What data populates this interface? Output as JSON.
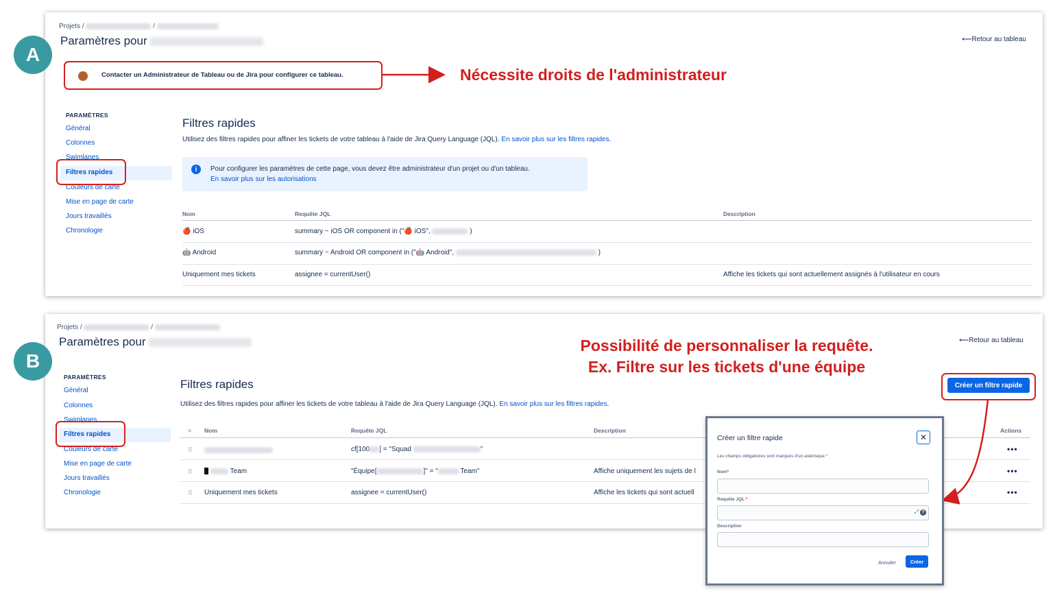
{
  "badges": {
    "a": "A",
    "b": "B"
  },
  "panel_a": {
    "breadcrumb": {
      "root": "Projets",
      "sep": "/"
    },
    "title_prefix": "Paramètres pour",
    "back_link": "Retour au tableau",
    "warning": "Contacter un Administrateur de Tableau ou de Jira pour configurer ce tableau.",
    "nav": {
      "heading": "PARAMÈTRES",
      "items": [
        "Général",
        "Colonnes",
        "Swimlanes",
        "Filtres rapides",
        "Couleurs de carte",
        "Mise en page de carte",
        "Jours travaillés",
        "Chronologie"
      ]
    },
    "section_title": "Filtres rapides",
    "section_desc": "Utilisez des filtres rapides pour affiner les tickets de votre tableau à l'aide de Jira Query Language (JQL).",
    "section_link": "En savoir plus sur les filtres rapides.",
    "info": {
      "text": "Pour configurer les paramètres de cette page, vous devez être administrateur d'un projet ou d'un tableau.",
      "link": "En savoir plus sur les autorisations"
    },
    "table": {
      "headers": [
        "Nom",
        "Requête JQL",
        "Description"
      ],
      "rows": [
        {
          "name": "🍎 iOS",
          "query": "summary ~ iOS OR component in (\"🍎 iOS\",",
          "query_end": ")",
          "description": ""
        },
        {
          "name": "🤖 Android",
          "query": "summary ~ Android OR component in (\"🤖 Android\",",
          "query_end": ")",
          "description": ""
        },
        {
          "name": "Uniquement mes tickets",
          "query": "assignee = currentUser()",
          "query_end": "",
          "description": "Affiche les tickets qui sont actuellement assignés à l'utilisateur en cours"
        }
      ]
    }
  },
  "annotations": {
    "a": "Nécessite droits de l'administrateur",
    "b_line1": "Possibilité de personnaliser la requête.",
    "b_line2": "Ex. Filtre sur les tickets d'une équipe"
  },
  "panel_b": {
    "breadcrumb": {
      "root": "Projets",
      "sep": "/"
    },
    "title_prefix": "Paramètres pour",
    "back_link": "Retour au tableau",
    "nav": {
      "heading": "PARAMÈTRES",
      "items": [
        "Général",
        "Colonnes",
        "Swimlanes",
        "Filtres rapides",
        "Couleurs de carte",
        "Mise en page de carte",
        "Jours travaillés",
        "Chronologie"
      ]
    },
    "section_title": "Filtres rapides",
    "section_desc": "Utilisez des filtres rapides pour affiner les tickets de votre tableau à l'aide de Jira Query Language (JQL).",
    "section_link": "En savoir plus sur les filtres rapides.",
    "create_button": "Créer un filtre rapide",
    "table": {
      "headers": [
        "Nom",
        "Requête JQL",
        "Description",
        "Actions"
      ],
      "rows": [
        {
          "name": "",
          "query_a": "cf[100",
          "query_b": "] = \"Squad",
          "query_c": "\"",
          "description": ""
        },
        {
          "name": "Team",
          "query_a": "\"Équipe[",
          "query_b": "]\" = \"",
          "query_c": "Team\"",
          "description": "Affiche uniquement les sujets de l"
        },
        {
          "name": "Uniquement mes tickets",
          "query_a": "assignee = currentUser()",
          "query_b": "",
          "query_c": "",
          "description": "Affiche les tickets qui sont actuell"
        }
      ],
      "action_label": "•••"
    }
  },
  "modal": {
    "title": "Créer un filtre rapide",
    "required_note": "Les champs obligatoires sont marqués d'un astérisque",
    "fields": {
      "name": "Nom",
      "jql": "Requête JQL",
      "description": "Description"
    },
    "cancel": "Annuler",
    "submit": "Créer"
  }
}
